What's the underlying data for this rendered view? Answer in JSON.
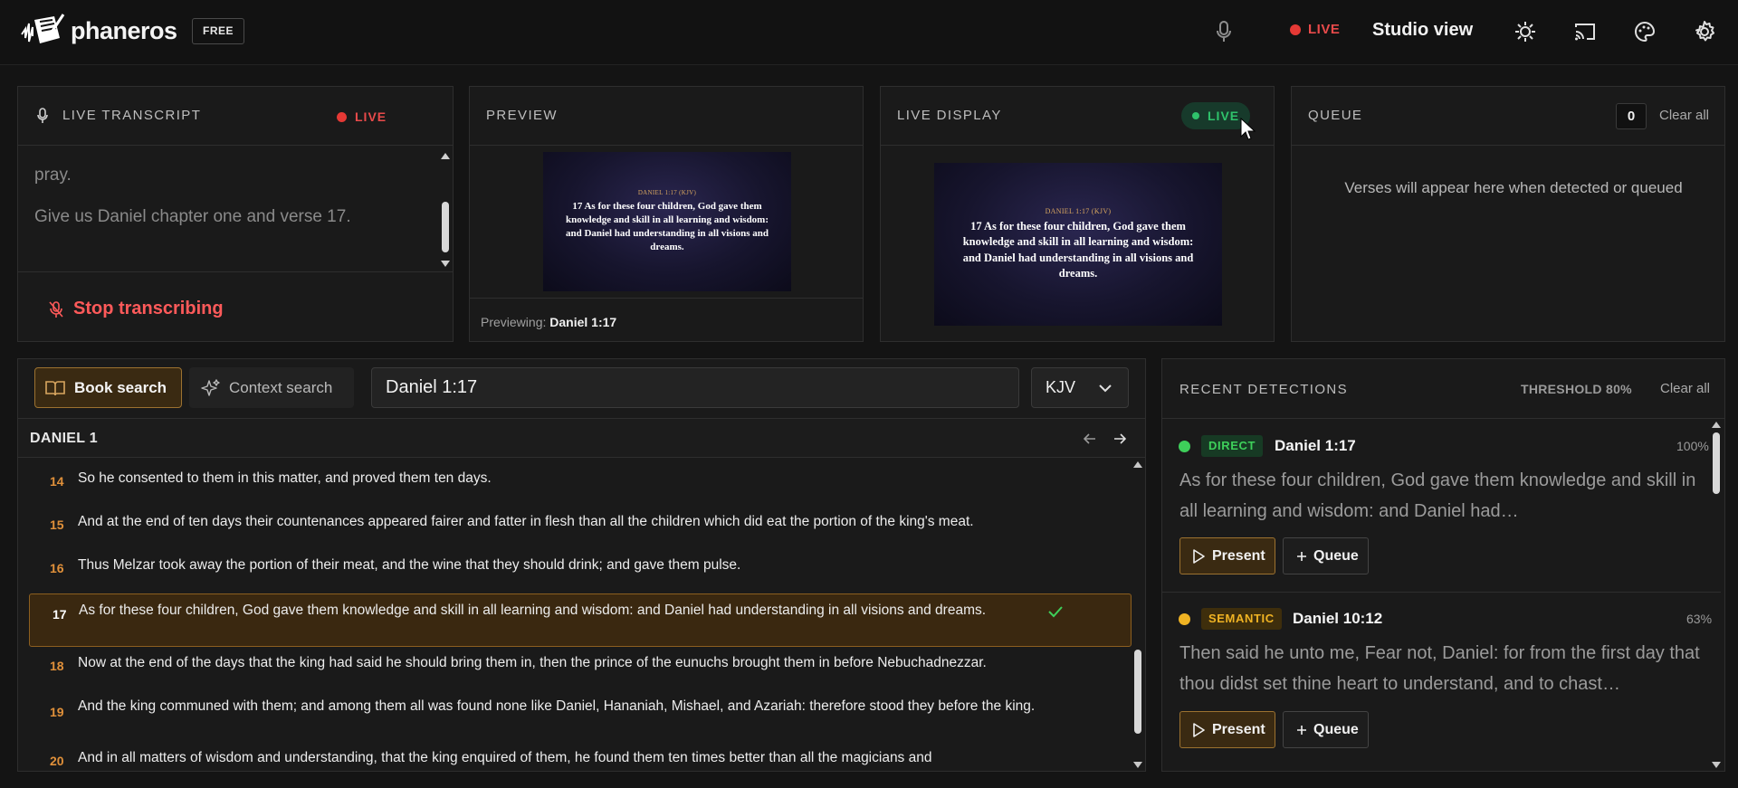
{
  "app": {
    "name": "phaneros",
    "plan": "FREE"
  },
  "topbar": {
    "live_label": "LIVE",
    "view_label": "Studio view"
  },
  "transcript": {
    "title": "LIVE TRANSCRIPT",
    "live_label": "LIVE",
    "lines": [
      "pray.",
      "Give us Daniel chapter one and verse 17."
    ],
    "stop_label": "Stop transcribing"
  },
  "preview": {
    "title": "PREVIEW",
    "slide_ref": "DANIEL 1:17 (KJV)",
    "slide_text": "17 As for these four children, God gave them knowledge and skill in all learning and wisdom: and Daniel had understanding in all visions and dreams.",
    "footer_prefix": "Previewing:",
    "footer_ref": "Daniel 1:17"
  },
  "live_display": {
    "title": "LIVE DISPLAY",
    "live_label": "LIVE",
    "slide_ref": "DANIEL 1:17 (KJV)",
    "slide_text": "17 As for these four children, God gave them knowledge and skill in all learning and wisdom: and Daniel had understanding in all visions and dreams."
  },
  "queue": {
    "title": "QUEUE",
    "count": "0",
    "clear_label": "Clear all",
    "empty_text": "Verses will appear here when detected or queued"
  },
  "search": {
    "tabs": [
      "Book search",
      "Context search"
    ],
    "query": "Daniel 1:17",
    "version": "KJV",
    "chapter_title": "DANIEL 1",
    "verses": [
      {
        "num": "14",
        "text": "So he consented to them in this matter, and proved them ten days."
      },
      {
        "num": "15",
        "text": "And at the end of ten days their countenances appeared fairer and fatter in flesh than all the children which did eat the portion of the king's meat."
      },
      {
        "num": "16",
        "text": "Thus Melzar took away the portion of their meat, and the wine that they should drink; and gave them pulse."
      },
      {
        "num": "17",
        "text": "As for these four children, God gave them knowledge and skill in all learning and wisdom: and Daniel had understanding in all visions and dreams."
      },
      {
        "num": "18",
        "text": "Now at the end of the days that the king had said he should bring them in, then the prince of the eunuchs brought them in before Nebuchadnezzar."
      },
      {
        "num": "19",
        "text": "And the king communed with them; and among them all was found none like Daniel, Hananiah, Mishael, and Azariah: therefore stood they before the king."
      },
      {
        "num": "20",
        "text": "And in all matters of wisdom and understanding, that the king enquired of them, he found them ten times better than all the magicians and"
      }
    ]
  },
  "detections": {
    "title": "RECENT DETECTIONS",
    "threshold_label": "THRESHOLD 80%",
    "clear_label": "Clear all",
    "present_label": "Present",
    "queue_label": "Queue",
    "items": [
      {
        "type": "DIRECT",
        "ref": "Daniel 1:17",
        "confidence": "100%",
        "text": "As for these four children, God gave them knowledge and skill in all learning and wisdom: and Daniel had…",
        "color": "#3ecf5a"
      },
      {
        "type": "SEMANTIC",
        "ref": "Daniel 10:12",
        "confidence": "63%",
        "text": "Then said he unto me, Fear not, Daniel: for from the first day that thou didst set thine heart to understand, and to chast…",
        "color": "#f0b323"
      }
    ]
  },
  "colors": {
    "accent": "#9c7230",
    "live_red": "#e53935",
    "live_green": "#2fc26b",
    "verse_number": "#e0903a"
  }
}
